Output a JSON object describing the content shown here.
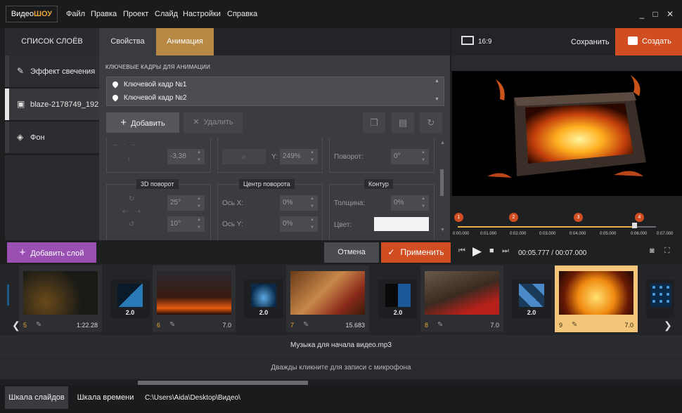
{
  "app": {
    "logo_a": "Видео",
    "logo_b": "ШОУ"
  },
  "menu": [
    "Файл",
    "Правка",
    "Проект",
    "Слайд",
    "Настройки",
    "Справка"
  ],
  "window_controls": [
    "_",
    "□",
    "✕"
  ],
  "layers": {
    "header": "СПИСОК СЛОЁВ",
    "items": [
      {
        "label": "Эффект свечения",
        "icon": "magic-wand-icon"
      },
      {
        "label": "blaze-2178749_192...",
        "icon": "image-icon"
      },
      {
        "label": "Фон",
        "icon": "paint-bucket-icon"
      }
    ],
    "add_label": "Добавить слой"
  },
  "tabs": {
    "properties": "Свойства",
    "animation": "Анимация"
  },
  "keyframes": {
    "title": "КЛЮЧЕВЫЕ КАДРЫ ДЛЯ АНИМАЦИИ",
    "items": [
      "Ключевой кадр №1",
      "Ключевой кадр №2"
    ],
    "add_label": "Добавить",
    "delete_label": "Удалить"
  },
  "props": {
    "pos_value": "-3,38",
    "zoom_label": "Y:",
    "zoom_value": "249%",
    "rotation_label": "Поворот:",
    "rotation_value": "0°",
    "rot3d_title": "3D поворот",
    "rot3d_a": "25°",
    "rot3d_b": "10°",
    "center_title": "Центр поворота",
    "axis_x_label": "Ось X:",
    "axis_x_value": "0%",
    "axis_y_label": "Ось Y:",
    "axis_y_value": "0%",
    "contour_title": "Контур",
    "thickness_label": "Толщина:",
    "thickness_value": "0%",
    "color_label": "Цвет:"
  },
  "actions": {
    "cancel": "Отмена",
    "apply": "Применить"
  },
  "preview": {
    "ratio": "16:9",
    "save": "Сохранить",
    "create": "Создать",
    "time_current": "00:05.777",
    "time_sep": " / ",
    "time_total": "00:07.000",
    "markers": [
      "1",
      "2",
      "3",
      "4"
    ],
    "ticks": [
      "0:00.000",
      "0:01.000",
      "0:02.000",
      "0:03.000",
      "0:04.000",
      "0:05.000",
      "0:06.000",
      "0:07.000"
    ]
  },
  "slides": [
    {
      "num": "5",
      "dur": "1:22.28"
    },
    {
      "num": "6",
      "dur": "7.0"
    },
    {
      "num": "7",
      "dur": "15.683"
    },
    {
      "num": "8",
      "dur": "7.0"
    },
    {
      "num": "9",
      "dur": "7.0"
    }
  ],
  "transitions": [
    "2.0",
    "2.0",
    "2.0",
    "2.0"
  ],
  "tracks": {
    "music": "Музыка для начала видео.mp3",
    "mic": "Дважды кликните для записи с микрофона"
  },
  "bottom": {
    "slides_tab": "Шкала слайдов",
    "timeline_tab": "Шкала времени",
    "path": "C:\\Users\\Aida\\Desktop\\Видео\\"
  },
  "colors": {
    "accent_orange": "#d14e23",
    "tab_gold": "#b88945",
    "add_layer_purple": "#9a4fb2"
  }
}
